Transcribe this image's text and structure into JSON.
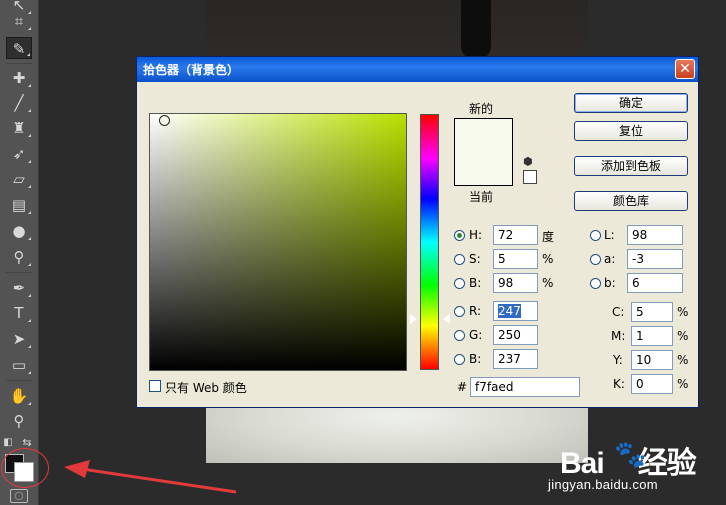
{
  "dialog": {
    "title": "拾色器（背景色）",
    "close_symbol": "✕",
    "new_label": "新的",
    "current_label": "当前",
    "preview_color": "#f7faed",
    "buttons": {
      "ok": "确定",
      "reset": "复位",
      "add_to_swatches": "添加到色板",
      "color_libraries": "颜色库"
    },
    "hsb": {
      "h": {
        "label": "H:",
        "value": "72",
        "unit": "度"
      },
      "s": {
        "label": "S:",
        "value": "5",
        "unit": "%"
      },
      "b": {
        "label": "B:",
        "value": "98",
        "unit": "%"
      }
    },
    "rgb": {
      "r": {
        "label": "R:",
        "value": "247"
      },
      "g": {
        "label": "G:",
        "value": "250"
      },
      "b": {
        "label": "B:",
        "value": "237"
      }
    },
    "lab": {
      "l": {
        "label": "L:",
        "value": "98"
      },
      "a": {
        "label": "a:",
        "value": "-3"
      },
      "b": {
        "label": "b:",
        "value": "6"
      }
    },
    "cmyk": {
      "c": {
        "label": "C:",
        "value": "5",
        "unit": "%"
      },
      "m": {
        "label": "M:",
        "value": "1",
        "unit": "%"
      },
      "y": {
        "label": "Y:",
        "value": "10",
        "unit": "%"
      },
      "k": {
        "label": "K:",
        "value": "0",
        "unit": "%"
      }
    },
    "hex": {
      "label": "#",
      "value": "f7faed"
    },
    "web_only_label": "只有 Web 颜色",
    "selected_mode": "H"
  },
  "toolbar": {
    "tools": [
      {
        "name": "move-tool-icon",
        "glyph": "↖"
      },
      {
        "name": "crop-tool-icon",
        "glyph": "⌗"
      },
      {
        "name": "eyedropper-tool-icon",
        "glyph": "✎"
      },
      {
        "name": "healing-brush-icon",
        "glyph": "✚"
      },
      {
        "name": "brush-tool-icon",
        "glyph": "╱"
      },
      {
        "name": "clone-stamp-icon",
        "glyph": "♜"
      },
      {
        "name": "history-brush-icon",
        "glyph": "➶"
      },
      {
        "name": "eraser-tool-icon",
        "glyph": "▱"
      },
      {
        "name": "gradient-tool-icon",
        "glyph": "▤"
      },
      {
        "name": "blur-tool-icon",
        "glyph": "●"
      },
      {
        "name": "dodge-tool-icon",
        "glyph": "⚲"
      },
      {
        "name": "pen-tool-icon",
        "glyph": "✒"
      },
      {
        "name": "type-tool-icon",
        "glyph": "T"
      },
      {
        "name": "path-select-icon",
        "glyph": "➤"
      },
      {
        "name": "shape-tool-icon",
        "glyph": "▭"
      },
      {
        "name": "hand-tool-icon",
        "glyph": "✋"
      },
      {
        "name": "zoom-tool-icon",
        "glyph": "⚲"
      }
    ],
    "foreground_color": "#111111",
    "background_color": "#ffffff",
    "swap_glyph": "⇆",
    "default_colors_glyph": "◧",
    "quick_mask_glyph": "◯"
  },
  "watermark": {
    "brand_left": "Bai",
    "paw": "🐾",
    "brand_right": "经验",
    "site": "jingyan.baidu.com"
  },
  "annotation": {
    "color": "#e23a3a"
  }
}
